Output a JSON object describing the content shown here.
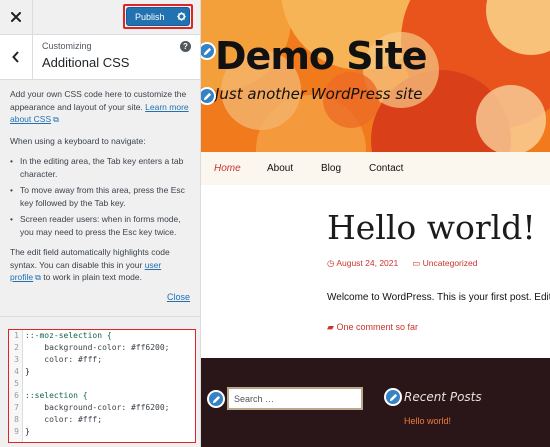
{
  "topbar": {
    "close_icon": "close-icon",
    "publish_label": "Publish",
    "publish_icon": "gear-icon"
  },
  "section": {
    "customizing": "Customizing",
    "title": "Additional CSS",
    "help_icon": "help-icon"
  },
  "description": {
    "intro": "Add your own CSS code here to customize the appearance and layout of your site.",
    "learn_more": "Learn more about CSS",
    "keyboard_intro": "When using a keyboard to navigate:",
    "bullets": [
      "In the editing area, the Tab key enters a tab character.",
      "To move away from this area, press the Esc key followed by the Tab key.",
      "Screen reader users: when in forms mode, you may need to press the Esc key twice."
    ],
    "highlight_text": "The edit field automatically highlights code syntax. You can disable this in your",
    "user_profile": "user profile",
    "plain_text": "to work in plain text mode.",
    "close": "Close"
  },
  "editor": {
    "line_numbers": [
      "1",
      "2",
      "3",
      "4",
      "5",
      "6",
      "7",
      "8",
      "9"
    ],
    "lines": [
      "::-moz-selection {",
      "    background-color: #ff6200;",
      "    color: #fff;",
      "}",
      "",
      "::selection {",
      "    background-color: #ff6200;",
      "    color: #fff;",
      "}"
    ]
  },
  "preview": {
    "site_title": "Demo Site",
    "tagline": "Just another WordPress site",
    "menu": [
      "Home",
      "About",
      "Blog",
      "Contact"
    ],
    "post_title": "Hello world!",
    "post_date": "August 24, 2021",
    "post_category": "Uncategorized",
    "post_excerpt": "Welcome to WordPress. This is your first post. Edit",
    "comments": "One comment so far",
    "search_placeholder": "Search …",
    "recent_posts_title": "Recent Posts",
    "recent_posts": [
      "Hello world!"
    ]
  },
  "colors": {
    "accent": "#2271b1",
    "highlight_box": "#e02424",
    "site_link": "#c9342c",
    "hero_orange": "#f07a1c",
    "footer_bg": "#2a1618"
  }
}
